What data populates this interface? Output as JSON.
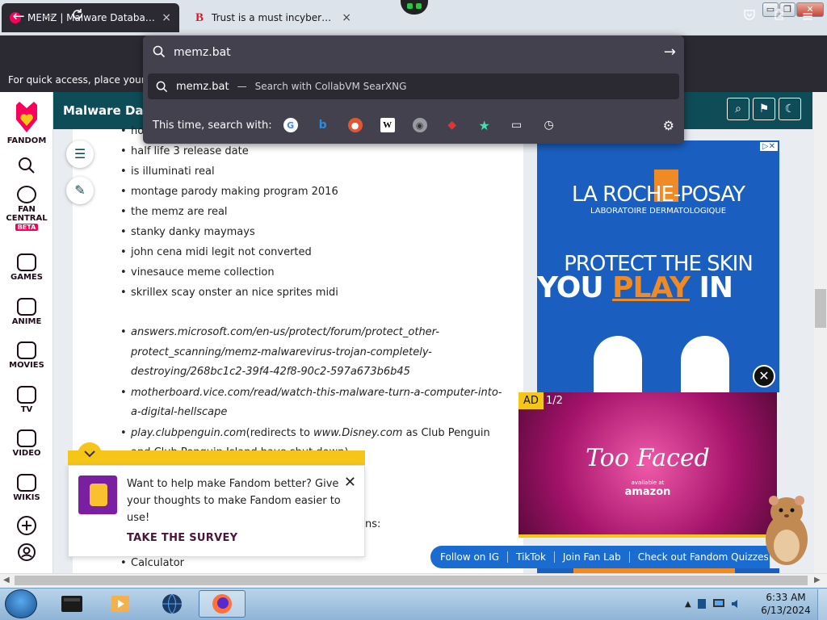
{
  "tabs": [
    {
      "title": "MEMZ | Malware Database Wiki",
      "favicon": "fandom-favicon",
      "active": true
    },
    {
      "title": "Trust is a must incybersecurity",
      "favicon": "b-favicon",
      "active": false
    }
  ],
  "tab_close_glyph": "×",
  "window_controls": {
    "minimize": "▭",
    "restore": "❐",
    "close": "✕"
  },
  "bookmarks_bar": {
    "text": "For quick access, place your bo"
  },
  "urlbar": {
    "value": "memz.bat",
    "suggestion": {
      "term": "memz.bat",
      "separator": "—",
      "action": "Search with CollabVM SearXNG"
    },
    "one_time_label": "This time, search with:",
    "engines": [
      "google",
      "bing",
      "duckduckgo",
      "wikipedia",
      "searxng",
      "ebay",
      "bookmarks",
      "tabs",
      "history"
    ]
  },
  "rail": {
    "items": [
      {
        "label": "FANDOM"
      },
      {
        "label": "FAN"
      },
      {
        "label": "CENTRAL"
      },
      {
        "label": "BETA"
      },
      {
        "label": "GAMES"
      },
      {
        "label": "ANIME"
      },
      {
        "label": "MOVIES"
      },
      {
        "label": "TV"
      },
      {
        "label": "VIDEO"
      },
      {
        "label": "WIKIS"
      }
    ]
  },
  "wiki": {
    "title": "Malware Dat"
  },
  "article": {
    "bullets": [
      "ho",
      "half life 3 release date",
      "is illuminati real",
      "montage parody making program 2016",
      "the memz are real",
      "stanky danky maymays",
      "john cena midi legit not converted",
      "vinesauce meme collection",
      "skrillex scay onster an nice sprites midi"
    ],
    "links": [
      "answers.microsoft.com/en-us/protect/forum/protect_other-protect_scanning/memz-malwarevirus-trojan-completely-destroying/268bc1c2-39f4-42f8-90c2-597a673b6b45",
      "motherboard.vice.com/read/watch-this-malware-turn-a-computer-into-a-digital-hellscape"
    ],
    "penguin": {
      "url": "play.clubpenguin.com",
      "note_pre": "(redirects to ",
      "note_url": "www.Disney.com",
      "note_post": " as Club Penguin and Club Penguin Island have shut down)"
    },
    "ns_cut": "ns:",
    "calculator": "Calculator"
  },
  "survey": {
    "text": "Want to help make Fandom better? Give your thoughts to make Fandom easier to use!",
    "cta": "TAKE THE SURVEY",
    "close": "✕"
  },
  "ads": {
    "adchoices": "▷✕",
    "laroche": {
      "logo": "LA ROCHE-POSAY",
      "sub": "LABORATOIRE DERMATOLOGIQUE",
      "headline1": "PROTECT THE SKIN",
      "headline2a": "YOU ",
      "headline2b": "PLAY",
      "headline2c": " IN"
    },
    "close": "✕",
    "video": {
      "badge": "AD",
      "count": "1/2",
      "brand": "Too Faced",
      "available": "available at",
      "store": "amazon"
    }
  },
  "social_bar": [
    "Follow on IG",
    "TikTok",
    "Join Fan Lab",
    "Check out Fandom Quizzes and"
  ],
  "taskbar": {
    "time": "6:33 AM",
    "date": "6/13/2024"
  },
  "colors": {
    "fandom_pink": "#fa005a",
    "wiki_teal": "#0e4d57",
    "survey_yellow": "#f5c518",
    "chrome_dark": "#2b2a33"
  }
}
